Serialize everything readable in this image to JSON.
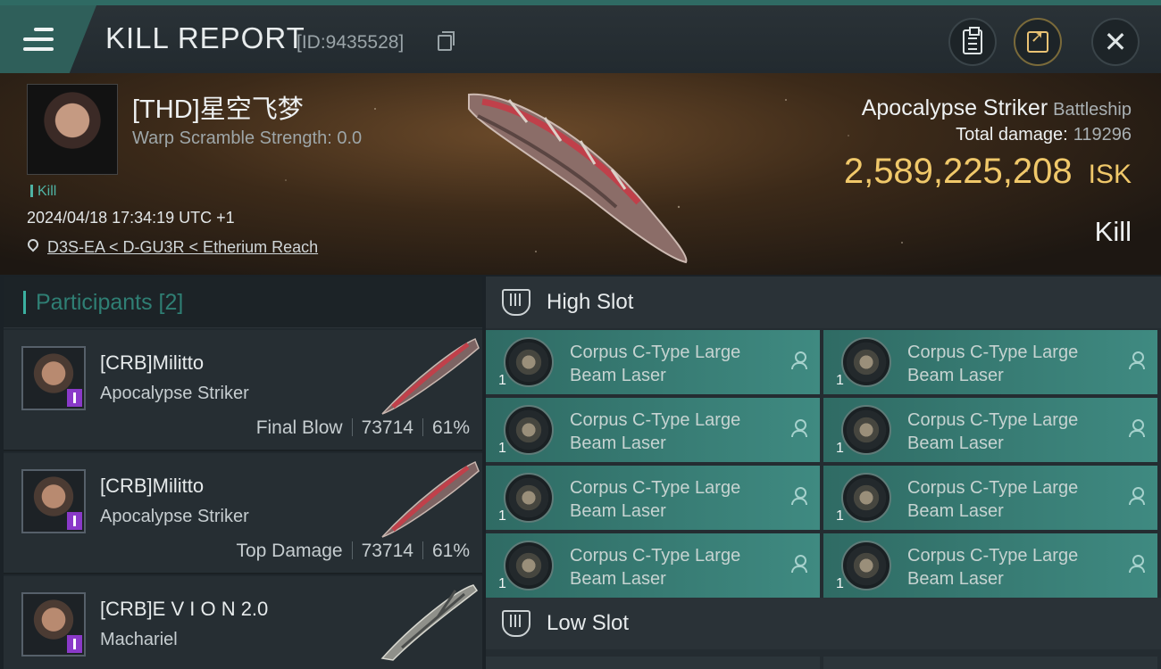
{
  "header": {
    "title": "KILL REPORT",
    "report_id": "[ID:9435528]",
    "icons": [
      "menu-icon",
      "copy-icon",
      "clipboard-icon",
      "share-icon",
      "close-icon"
    ]
  },
  "victim": {
    "pilot_name": "[THD]星空飞梦",
    "warp_scramble": "Warp Scramble Strength: 0.0",
    "kill_tag": "Kill",
    "timestamp": "2024/04/18 17:34:19 UTC +1",
    "location": "D3S-EA < D-GU3R < Etherium Reach",
    "ship_name": "Apocalypse Striker",
    "ship_class": "Battleship",
    "total_damage_label": "Total damage:",
    "total_damage": "119296",
    "isk_value": "2,589,225,208",
    "isk_unit": "ISK",
    "outcome": "Kill"
  },
  "participants": {
    "header": "Participants [2]",
    "rows": [
      {
        "name": "[CRB]Militto",
        "ship": "Apocalypse Striker",
        "tag": "Final Blow",
        "damage": "73714",
        "percent": "61%"
      },
      {
        "name": "[CRB]Militto",
        "ship": "Apocalypse Striker",
        "tag": "Top Damage",
        "damage": "73714",
        "percent": "61%"
      },
      {
        "name": "[CRB]E V I O N 2.0",
        "ship": "Machariel",
        "tag": "",
        "damage": "",
        "percent": ""
      }
    ]
  },
  "slots": {
    "high_title": "High Slot",
    "low_title": "Low Slot",
    "high_modules": [
      {
        "name": "Corpus C-Type Large Beam Laser",
        "qty": "1"
      },
      {
        "name": "Corpus C-Type Large Beam Laser",
        "qty": "1"
      },
      {
        "name": "Corpus C-Type Large Beam Laser",
        "qty": "1"
      },
      {
        "name": "Corpus C-Type Large Beam Laser",
        "qty": "1"
      },
      {
        "name": "Corpus C-Type Large Beam Laser",
        "qty": "1"
      },
      {
        "name": "Corpus C-Type Large Beam Laser",
        "qty": "1"
      },
      {
        "name": "Corpus C-Type Large Beam Laser",
        "qty": "1"
      },
      {
        "name": "Corpus C-Type Large Beam Laser",
        "qty": "1"
      }
    ]
  },
  "colors": {
    "accent_teal": "#3bb0a0",
    "isk_gold": "#f0c86a",
    "module_bg": "#3f8a81"
  }
}
